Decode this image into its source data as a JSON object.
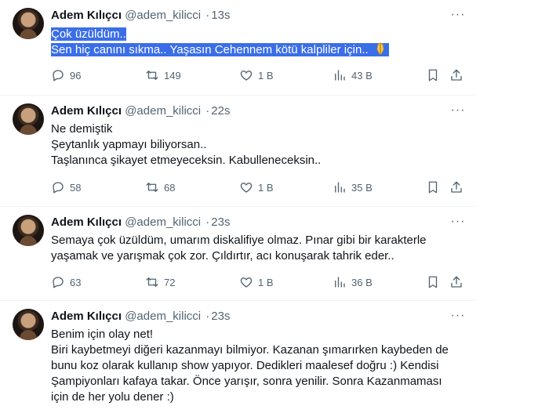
{
  "tweets": [
    {
      "author": "Adem Kılıçcı",
      "handle": "@adem_kilicci",
      "separator": "·",
      "time": "13s",
      "lines": [
        "Çok üzüldüm..",
        "Sen hiç canını sıkma.. Yaşasın Cehennem kötü kalpliler için.."
      ],
      "emoji": "praying-hands",
      "replies": "96",
      "retweets": "149",
      "likes": "1 B",
      "views": "43 B"
    },
    {
      "author": "Adem Kılıçcı",
      "handle": "@adem_kilicci",
      "separator": "·",
      "time": "22s",
      "lines": [
        "Ne demiştik",
        "Şeytanlık yapmayı biliyorsan..",
        "Taşlanınca şikayet etmeyeceksin. Kabulleneceksin.."
      ],
      "replies": "58",
      "retweets": "68",
      "likes": "1 B",
      "views": "35 B"
    },
    {
      "author": "Adem Kılıçcı",
      "handle": "@adem_kilicci",
      "separator": "·",
      "time": "23s",
      "lines": [
        "Semaya çok üzüldüm, umarım diskalifiye olmaz. Pınar gibi bir karakterle",
        "yaşamak ve yarışmak çok zor. Çıldırtır, acı konuşarak tahrik eder.."
      ],
      "replies": "63",
      "retweets": "72",
      "likes": "1 B",
      "views": "36 B"
    },
    {
      "author": "Adem Kılıçcı",
      "handle": "@adem_kilicci",
      "separator": "·",
      "time": "23s",
      "lines": [
        "Benim için olay net!",
        "Biri kaybetmeyi diğeri kazanmayı bilmiyor. Kazanan şımarırken kaybeden de",
        "bunu koz olarak kullanıp show yapıyor. Dedikleri maalesef doğru :) Kendisi",
        "Şampiyonları kafaya takar. Önce yarışır, sonra yenilir. Sonra Kazanmaması",
        "için de her yolu dener :)"
      ]
    }
  ],
  "colors": {
    "highlight": "#3a6ee8",
    "text": "#0f1419",
    "muted": "#536471",
    "divider": "#eff3f4"
  },
  "icons": [
    "more-icon",
    "reply-icon",
    "retweet-icon",
    "like-icon",
    "views-icon",
    "bookmark-icon",
    "share-icon"
  ]
}
